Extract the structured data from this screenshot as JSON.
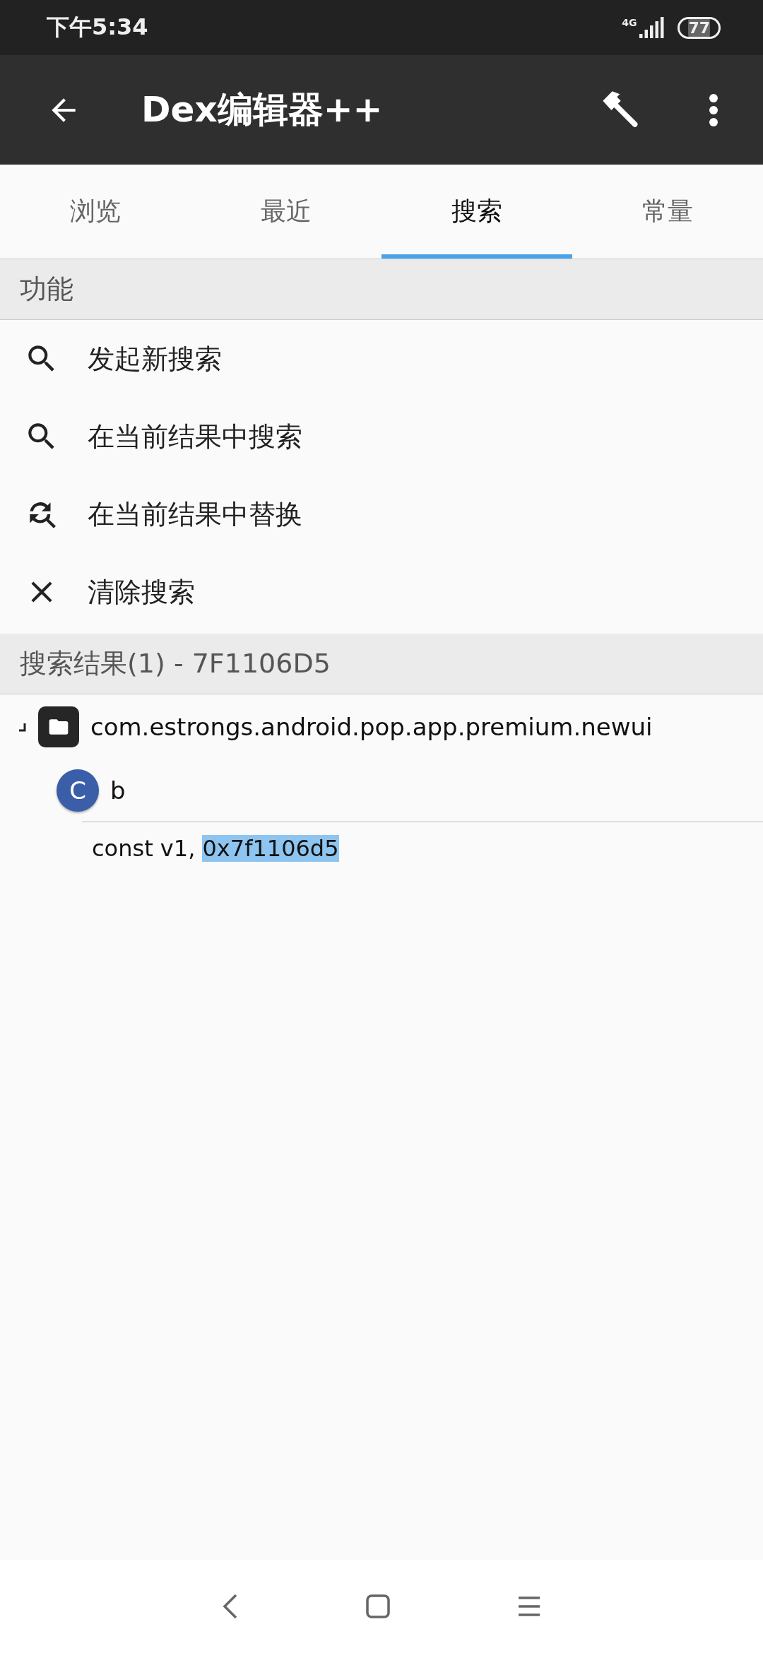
{
  "status_bar": {
    "time": "下午5:34",
    "network": "4G",
    "battery": "77"
  },
  "toolbar": {
    "title": "Dex编辑器++"
  },
  "tabs": [
    {
      "label": "浏览",
      "selected": false
    },
    {
      "label": "最近",
      "selected": false
    },
    {
      "label": "搜索",
      "selected": true
    },
    {
      "label": "常量",
      "selected": false
    }
  ],
  "functions": {
    "header": "功能",
    "items": [
      {
        "kind": "search",
        "label": "发起新搜索"
      },
      {
        "kind": "search",
        "label": "在当前结果中搜索"
      },
      {
        "kind": "replace",
        "label": "在当前结果中替换"
      },
      {
        "kind": "clear",
        "label": "清除搜索"
      }
    ]
  },
  "results": {
    "header": "搜索结果(1) - 7F1106D5",
    "tree": [
      {
        "kind": "package",
        "label": "com.estrongs.android.pop.app.premium.newui",
        "expanded": true,
        "children": [
          {
            "kind": "class",
            "badge": "C",
            "label": "b",
            "children": [
              {
                "kind": "code",
                "text": "const v1, ",
                "highlight": "0x7f1106d5"
              }
            ]
          }
        ]
      }
    ]
  }
}
